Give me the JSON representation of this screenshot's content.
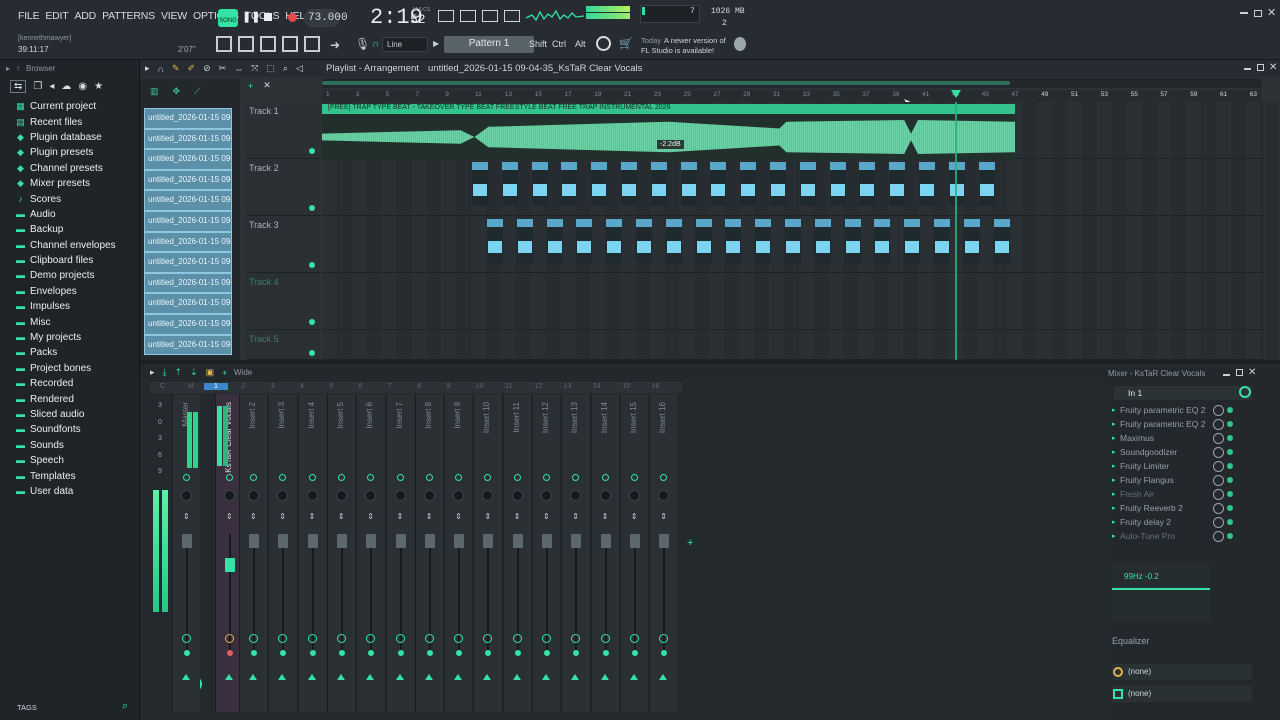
{
  "menu": [
    "FILE",
    "EDIT",
    "ADD",
    "PATTERNS",
    "VIEW",
    "OPTIONS",
    "TOOLS",
    "HELP"
  ],
  "transport": {
    "song_label": "SONG",
    "tempo": "73.000",
    "time": "2:19",
    "time_sub": "52",
    "time_unit": "M:S:CS",
    "cpu_count": "7",
    "memory": "1026 MB",
    "polyphony": "2"
  },
  "user": {
    "name": "[kennethmawyer]",
    "time": "39:11:17",
    "hint_time": "2'07\""
  },
  "toolbar": {
    "snap": "Line",
    "pattern": "Pattern 1",
    "shift": "Shift",
    "ctrl": "Ctrl",
    "alt": "Alt"
  },
  "news": {
    "date": "Today",
    "text1": "A newer version of",
    "text2": "FL Studio is available!"
  },
  "browser": {
    "title": "Browser",
    "tags": "TAGS",
    "items": [
      {
        "label": "Current project",
        "icon": "project-icon"
      },
      {
        "label": "Recent files",
        "icon": "recent-icon"
      },
      {
        "label": "Plugin database",
        "icon": "plug-icon"
      },
      {
        "label": "Plugin presets",
        "icon": "plug-icon"
      },
      {
        "label": "Channel presets",
        "icon": "plug-icon"
      },
      {
        "label": "Mixer presets",
        "icon": "plug-icon"
      },
      {
        "label": "Scores",
        "icon": "note-icon"
      },
      {
        "label": "Audio",
        "icon": "folder-icon"
      },
      {
        "label": "Backup",
        "icon": "folder-icon"
      },
      {
        "label": "Channel envelopes",
        "icon": "folder-icon"
      },
      {
        "label": "Clipboard files",
        "icon": "folder-icon"
      },
      {
        "label": "Demo projects",
        "icon": "folder-icon"
      },
      {
        "label": "Envelopes",
        "icon": "folder-icon"
      },
      {
        "label": "Impulses",
        "icon": "folder-icon"
      },
      {
        "label": "Misc",
        "icon": "folder-icon"
      },
      {
        "label": "My projects",
        "icon": "folder-icon"
      },
      {
        "label": "Packs",
        "icon": "folder-icon"
      },
      {
        "label": "Project bones",
        "icon": "folder-icon"
      },
      {
        "label": "Recorded",
        "icon": "folder-icon"
      },
      {
        "label": "Rendered",
        "icon": "folder-icon"
      },
      {
        "label": "Sliced audio",
        "icon": "folder-icon"
      },
      {
        "label": "Soundfonts",
        "icon": "folder-icon"
      },
      {
        "label": "Sounds",
        "icon": "folder-icon"
      },
      {
        "label": "Speech",
        "icon": "folder-icon"
      },
      {
        "label": "Templates",
        "icon": "folder-icon"
      },
      {
        "label": "User data",
        "icon": "folder-icon"
      }
    ]
  },
  "playlist": {
    "title": "Playlist - Arrangement",
    "project": "untitled_2026-01-15 09-04-35_KsTaR Clear Vocals",
    "clips": [
      "untitled_2026-01-15 09-...",
      "untitled_2026-01-15 09-...",
      "untitled_2026-01-15 09-...",
      "untitled_2026-01-15 09-...",
      "untitled_2026-01-15 09-...",
      "untitled_2026-01-15 09-...",
      "untitled_2026-01-15 09-...",
      "untitled_2026-01-15 09-...",
      "untitled_2026-01-15 09-...",
      "untitled_2026-01-15 09-...",
      "untitled_2026-01-15 09-...",
      "untitled_2026-01-15 09-..."
    ],
    "ruler": [
      "1",
      "3",
      "5",
      "7",
      "9",
      "11",
      "13",
      "15",
      "17",
      "19",
      "21",
      "23",
      "25",
      "27",
      "29",
      "31",
      "33",
      "35",
      "37",
      "39",
      "41",
      "43",
      "45",
      "47",
      "49",
      "51",
      "53",
      "55",
      "57",
      "59",
      "61",
      "63"
    ],
    "tracks": [
      "Track 1",
      "Track 2",
      "Track 3",
      "Track 4",
      "Track 5"
    ],
    "main_clip": "[FREE] TRAP TYPE BEAT - TAKEOVER  TYPE BEAT  FREESTYLE BEAT  FREE TRAP INSTRUMENTAL 2026",
    "gain": "-2.2dB"
  },
  "mixer": {
    "width_label": "Wide",
    "title": "Mixer - KsTaR Clear Vocals",
    "input": "In 1",
    "strip_numbers": [
      "C",
      "M",
      "1",
      "2",
      "3",
      "4",
      "5",
      "6",
      "7",
      "8",
      "9",
      "10",
      "11",
      "12",
      "13",
      "14",
      "15",
      "16"
    ],
    "scale": [
      "3",
      "0",
      "3",
      "6",
      "9"
    ],
    "strips": [
      "Master",
      "KsTaR Clear Vocals",
      "Insert 2",
      "Insert 3",
      "Insert 4",
      "Insert 5",
      "Insert 6",
      "Insert 7",
      "Insert 8",
      "Insert 9",
      "Insert 10",
      "Insert 11",
      "Insert 12",
      "Insert 13",
      "Insert 14",
      "Insert 15",
      "Insert 16"
    ],
    "effects": [
      "Fruity parametric EQ 2",
      "Fruity parametric EQ 2",
      "Maximus",
      "Soundgoodizer",
      "Fruity Limiter",
      "Fruity Flangus",
      "Fresh Air",
      "Fruity Reeverb 2",
      "Fruity delay 2",
      "Auto-Tune Pro"
    ],
    "eq_readout": "99Hz -0.2",
    "eq_label": "Equalizer",
    "out1": "(none)",
    "out2": "(none)"
  },
  "colors": {
    "accent": "#34e3a6",
    "clip_blue": "#5aa7cc",
    "wave": "#6fd3a8"
  }
}
